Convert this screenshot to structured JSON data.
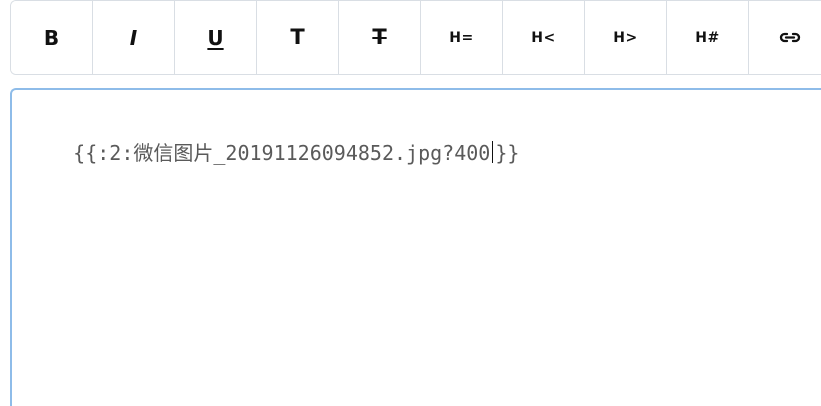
{
  "toolbar": {
    "bold_label": "B",
    "italic_label": "I",
    "underline_label": "U",
    "font_label": "T",
    "strikethrough_label": "T",
    "heading_equal_label": "H=",
    "heading_less_label": "H<",
    "heading_greater_label": "H>",
    "heading_number_label": "H#",
    "link_icon": "link-icon"
  },
  "editor": {
    "text_before_caret": "{{:2:微信图片_20191126094852.jpg?400",
    "text_after_caret": "}}"
  },
  "colors": {
    "toolbar_border": "#d9dee4",
    "editor_border": "#8ebce9",
    "text": "#5a5a5a",
    "button_text": "#111111"
  }
}
